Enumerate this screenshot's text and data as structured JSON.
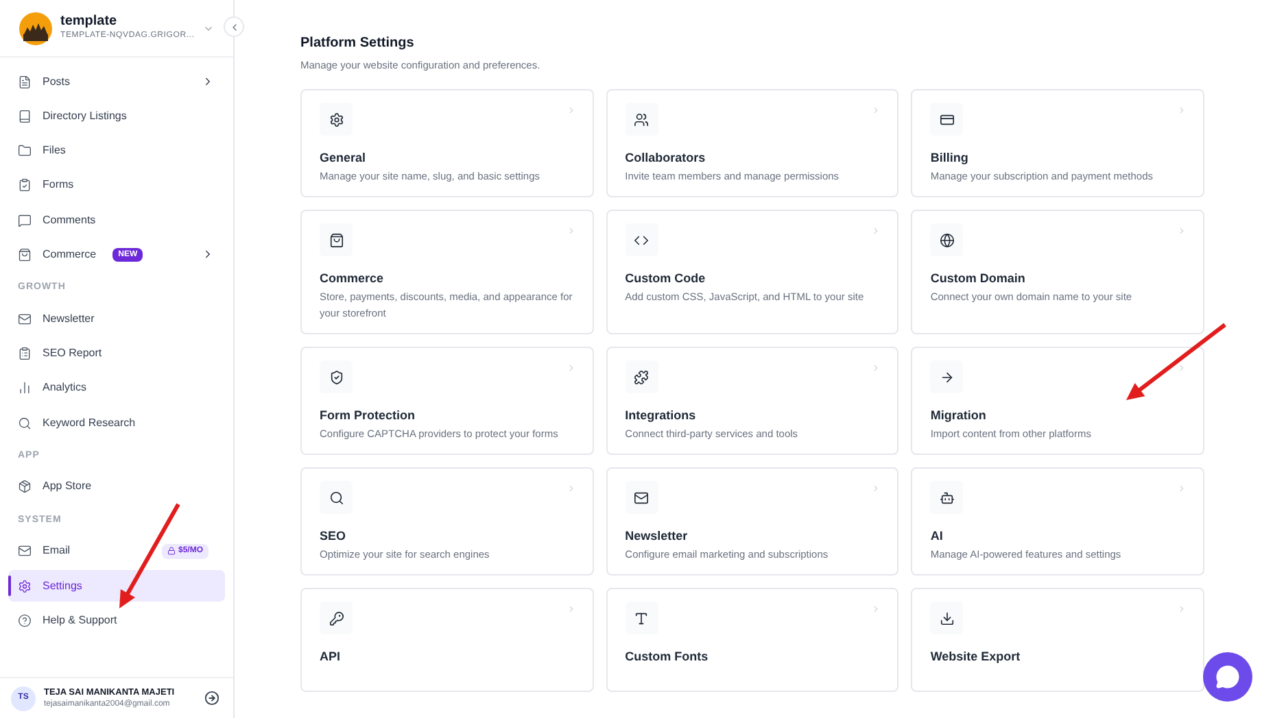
{
  "site": {
    "name": "template",
    "domain": "TEMPLATE-NQVDAG.GRIGOR..."
  },
  "sidebar": {
    "groups": [
      {
        "items": [
          {
            "label": "Posts",
            "selected": false,
            "submenu": true
          },
          {
            "label": "Directory Listings",
            "selected": false,
            "submenu": false
          },
          {
            "label": "Files",
            "selected": false,
            "submenu": false
          },
          {
            "label": "Forms",
            "selected": false,
            "submenu": false
          },
          {
            "label": "Comments",
            "selected": false,
            "submenu": false
          },
          {
            "label": "Commerce",
            "selected": false,
            "submenu": true,
            "badge": {
              "text": "NEW",
              "kind": "new"
            }
          }
        ]
      },
      {
        "heading": "GROWTH",
        "items": [
          {
            "label": "Newsletter",
            "selected": false,
            "submenu": false
          },
          {
            "label": "SEO Report",
            "selected": false,
            "submenu": false
          },
          {
            "label": "Analytics",
            "selected": false,
            "submenu": false
          },
          {
            "label": "Keyword Research",
            "selected": false,
            "submenu": false
          }
        ]
      },
      {
        "heading": "APP",
        "items": [
          {
            "label": "App Store",
            "selected": false,
            "submenu": false
          }
        ]
      },
      {
        "heading": "SYSTEM",
        "items": [
          {
            "label": "Email",
            "selected": false,
            "submenu": false,
            "badge": {
              "text": "$5/MO",
              "kind": "locked"
            }
          },
          {
            "label": "Settings",
            "selected": true,
            "submenu": false
          },
          {
            "label": "Help & Support",
            "selected": false,
            "submenu": false
          }
        ]
      }
    ]
  },
  "user": {
    "initials": "TS",
    "name": "TEJA SAI MANIKANTA MAJETI",
    "email": "tejasaimanikanta2004@gmail.com"
  },
  "page": {
    "title": "Platform Settings",
    "subtitle": "Manage your website configuration and preferences."
  },
  "cards": [
    {
      "title": "General",
      "description": "Manage your site name, slug, and basic settings"
    },
    {
      "title": "Collaborators",
      "description": "Invite team members and manage permissions"
    },
    {
      "title": "Billing",
      "description": "Manage your subscription and payment methods"
    },
    {
      "title": "Commerce",
      "description": "Store, payments, discounts, media, and appearance for your storefront"
    },
    {
      "title": "Custom Code",
      "description": "Add custom CSS, JavaScript, and HTML to your site"
    },
    {
      "title": "Custom Domain",
      "description": "Connect your own domain name to your site"
    },
    {
      "title": "Form Protection",
      "description": "Configure CAPTCHA providers to protect your forms"
    },
    {
      "title": "Integrations",
      "description": "Connect third-party services and tools"
    },
    {
      "title": "Migration",
      "description": "Import content from other platforms"
    },
    {
      "title": "SEO",
      "description": "Optimize your site for search engines"
    },
    {
      "title": "Newsletter",
      "description": "Configure email marketing and subscriptions"
    },
    {
      "title": "AI",
      "description": "Manage AI-powered features and settings"
    },
    {
      "title": "API"
    },
    {
      "title": "Custom Fonts"
    },
    {
      "title": "Website Export"
    }
  ]
}
